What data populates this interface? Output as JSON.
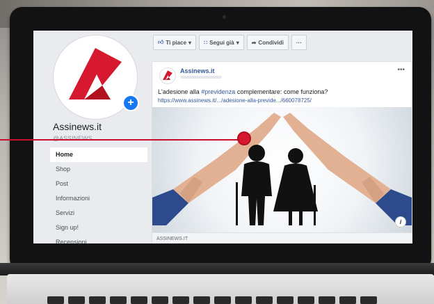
{
  "sidebar": {
    "page_name": "Assinews.it",
    "handle": "@ASSINEWS",
    "items": [
      {
        "label": "Home"
      },
      {
        "label": "Shop"
      },
      {
        "label": "Post"
      },
      {
        "label": "Informazioni"
      },
      {
        "label": "Servizi"
      },
      {
        "label": "Sign up!"
      },
      {
        "label": "Recensioni"
      }
    ]
  },
  "actions": {
    "like": "Ti piace",
    "follow": "Segui già",
    "share": "Condividi",
    "more": "···"
  },
  "post": {
    "author": "Assinews.it",
    "more": "•••",
    "text_before": "L'adesione alla ",
    "hashtag": "#previdenza",
    "text_after": " complementare: come funziona?",
    "link": "https://www.assinews.it/.../adesione-alla-previde.../660078725/",
    "domain": "ASSINEWS.IT",
    "info": "i"
  },
  "colors": {
    "accent": "#1877f2",
    "brand_red": "#d7192f",
    "link": "#365899"
  }
}
